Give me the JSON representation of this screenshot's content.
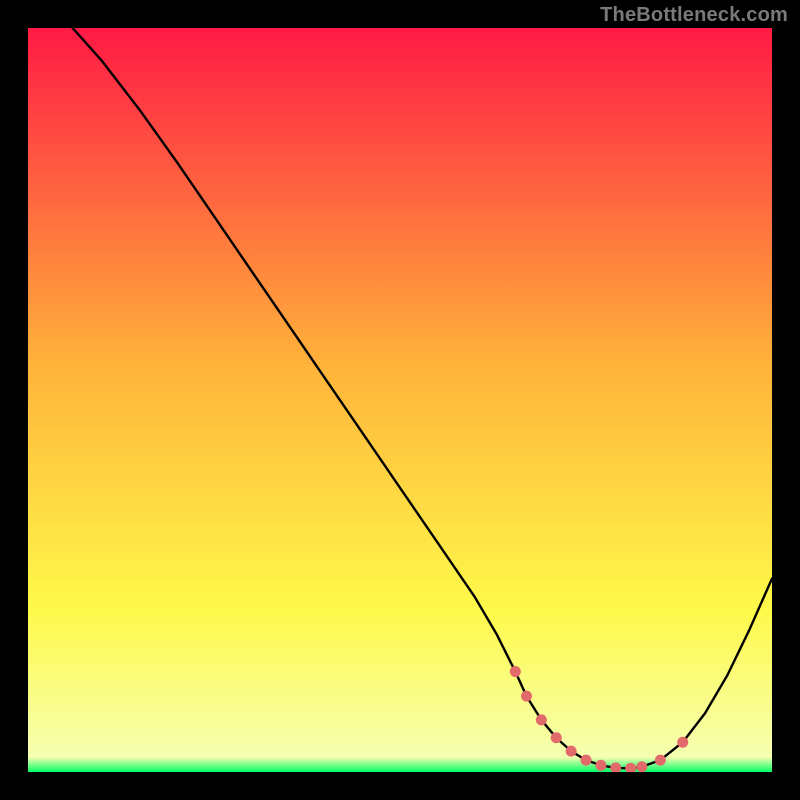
{
  "watermark": "TheBottleneck.com",
  "colors": {
    "bg": "#000000",
    "grad_top": "#ff1a45",
    "grad_mid": "#ffb23a",
    "grad_low": "#fff94a",
    "grad_bottom": "#00ff66",
    "curve": "#000000",
    "marker": "#e26a6a",
    "watermark": "#7a7a7a"
  },
  "chart_data": {
    "type": "line",
    "title": "",
    "xlabel": "",
    "ylabel": "",
    "xlim": [
      0,
      100
    ],
    "ylim": [
      0,
      100
    ],
    "series": [
      {
        "name": "curve",
        "x": [
          6,
          10,
          15,
          20,
          25,
          30,
          35,
          40,
          45,
          50,
          55,
          60,
          63,
          65.5,
          67,
          69,
          71,
          73,
          75,
          77,
          79,
          81,
          82.5,
          85,
          88,
          91,
          94,
          97,
          100
        ],
        "y": [
          100,
          95.5,
          89,
          82,
          74.7,
          67.4,
          60.1,
          52.8,
          45.5,
          38.2,
          30.9,
          23.6,
          18.5,
          13.5,
          10.2,
          7,
          4.6,
          2.8,
          1.6,
          0.9,
          0.55,
          0.5,
          0.7,
          1.6,
          4,
          7.9,
          13,
          19.2,
          26
        ]
      }
    ],
    "highlight_markers": {
      "name": "optimum-band",
      "x": [
        65.5,
        67,
        69,
        71,
        73,
        75,
        77,
        79,
        81,
        82.5,
        85,
        88
      ],
      "y": [
        13.5,
        10.2,
        7,
        4.6,
        2.8,
        1.6,
        0.9,
        0.55,
        0.5,
        0.7,
        1.6,
        4
      ]
    }
  }
}
